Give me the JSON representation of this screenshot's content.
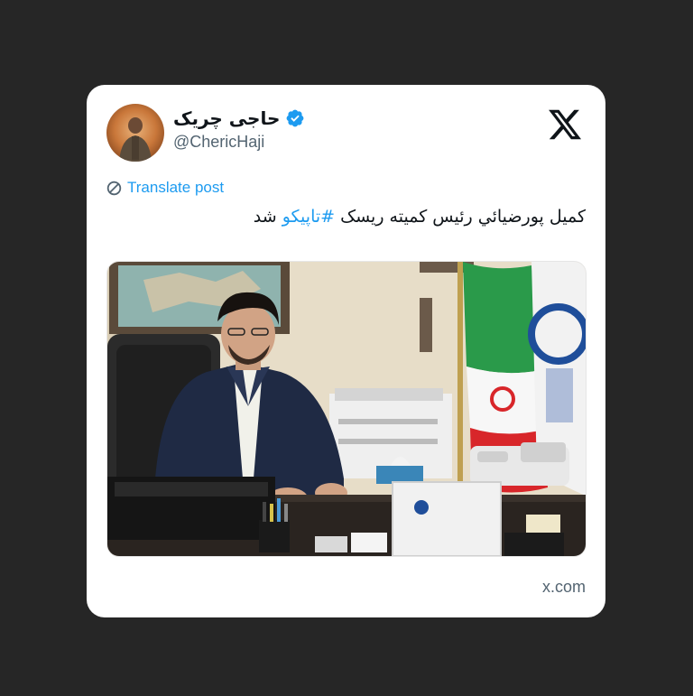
{
  "tweet": {
    "author": {
      "display_name": "حاجی چریک",
      "handle": "@ChericHaji",
      "verified": true
    },
    "translate_label": "Translate post",
    "text_before": "کمیل پورضیائي رئیس کمیته ریسک ",
    "hashtag": "#تاپیکو",
    "text_after": " شد",
    "source": "x.com"
  },
  "icons": {
    "verified": "verified-check-icon",
    "translate": "globe-icon",
    "brand": "x-logo-icon"
  },
  "colors": {
    "background": "#262626",
    "card": "#ffffff",
    "link": "#1d9bf0",
    "text": "#0f1419",
    "muted": "#536471"
  }
}
